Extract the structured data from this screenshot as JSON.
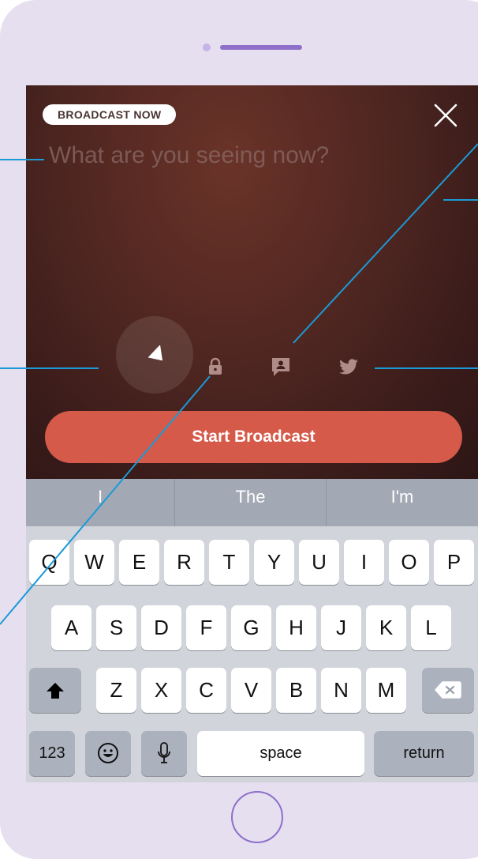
{
  "broadcast": {
    "badge_label": "BROADCAST NOW",
    "prompt_placeholder": "What are you seeing now?",
    "start_label": "Start Broadcast",
    "accent_color": "#d55a4a"
  },
  "predictions": [
    "I",
    "The",
    "I'm"
  ],
  "keyboard": {
    "row1": [
      "Q",
      "W",
      "E",
      "R",
      "T",
      "Y",
      "U",
      "I",
      "O",
      "P"
    ],
    "row2": [
      "A",
      "S",
      "D",
      "F",
      "G",
      "H",
      "J",
      "K",
      "L"
    ],
    "row3": [
      "Z",
      "X",
      "C",
      "V",
      "B",
      "N",
      "M"
    ],
    "numbers_label": "123",
    "space_label": "space",
    "return_label": "return"
  },
  "icons": {
    "close": "close-icon",
    "location": "location-arrow-icon",
    "lock": "lock-icon",
    "chat": "chat-bubble-person-icon",
    "twitter": "twitter-bird-icon",
    "shift": "shift-arrow-icon",
    "backspace": "backspace-icon",
    "emoji": "emoji-icon",
    "microphone": "microphone-icon"
  }
}
